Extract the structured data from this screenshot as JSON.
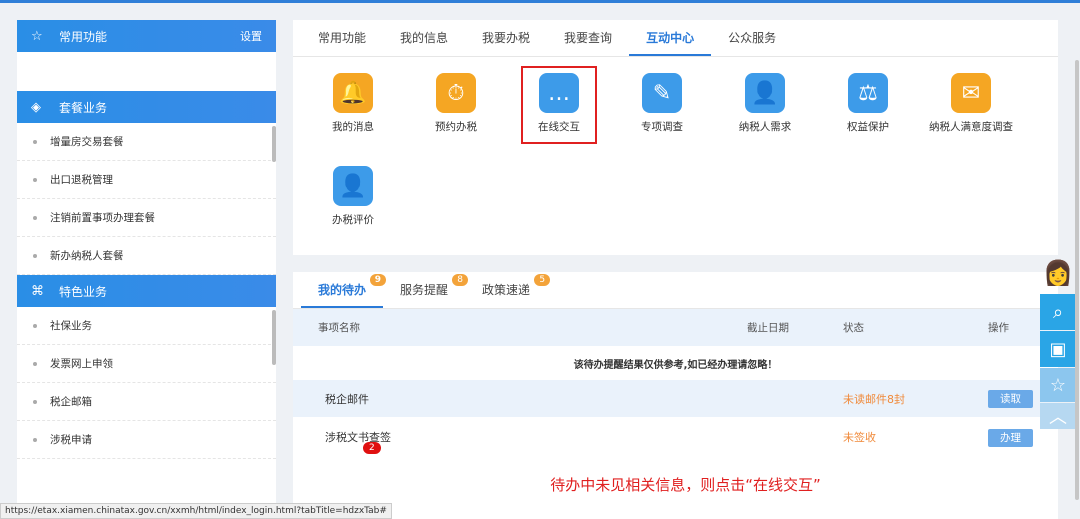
{
  "sidebar": {
    "common": {
      "title": "常用功能",
      "settings": "设置"
    },
    "package": {
      "title": "套餐业务",
      "items": [
        "增量房交易套餐",
        "出口退税管理",
        "注销前置事项办理套餐",
        "新办纳税人套餐"
      ]
    },
    "special": {
      "title": "特色业务",
      "items": [
        "社保业务",
        "发票网上申领",
        "税企邮箱",
        "涉税申请"
      ]
    }
  },
  "top_tabs": [
    "常用功能",
    "我的信息",
    "我要办税",
    "我要查询",
    "互动中心",
    "公众服务"
  ],
  "apps": [
    {
      "label": "我的消息",
      "icon": "bell-icon",
      "color": "#f5a623"
    },
    {
      "label": "预约办税",
      "icon": "stopwatch-icon",
      "color": "#f5a623"
    },
    {
      "label": "在线交互",
      "icon": "chat-icon",
      "color": "#3d9be9"
    },
    {
      "label": "专项调查",
      "icon": "edit-icon",
      "color": "#3d9be9"
    },
    {
      "label": "纳税人需求",
      "icon": "user-idea-icon",
      "color": "#3d9be9"
    },
    {
      "label": "权益保护",
      "icon": "gavel-icon",
      "color": "#3d9be9"
    },
    {
      "label": "纳税人满意度调查",
      "icon": "mail-heart-icon",
      "color": "#f5a623"
    },
    {
      "label": "办税评价",
      "icon": "user-edit-icon",
      "color": "#3d9be9"
    }
  ],
  "todo": {
    "tabs": [
      {
        "label": "我的待办",
        "count": "9"
      },
      {
        "label": "服务提醒",
        "count": "8"
      },
      {
        "label": "政策速递",
        "count": "5"
      }
    ],
    "headers": [
      "事项名称",
      "截止日期",
      "状态",
      "操作"
    ],
    "notice": "该待办提醒结果仅供参考,如已经办理请忽略！",
    "rows": [
      {
        "name": "税企邮件",
        "date": "",
        "status": "未读邮件8封",
        "action": "读取"
      },
      {
        "name": "涉税文书查签",
        "badge": "2",
        "date": "",
        "status": "未签收",
        "action": "办理"
      }
    ]
  },
  "annotation": "待办中未见相关信息，则点击“在线交互”",
  "status_url": "https://etax.xiamen.chinatax.gov.cn/xxmh/html/index_login.html?tabTitle=hdzxTab#"
}
